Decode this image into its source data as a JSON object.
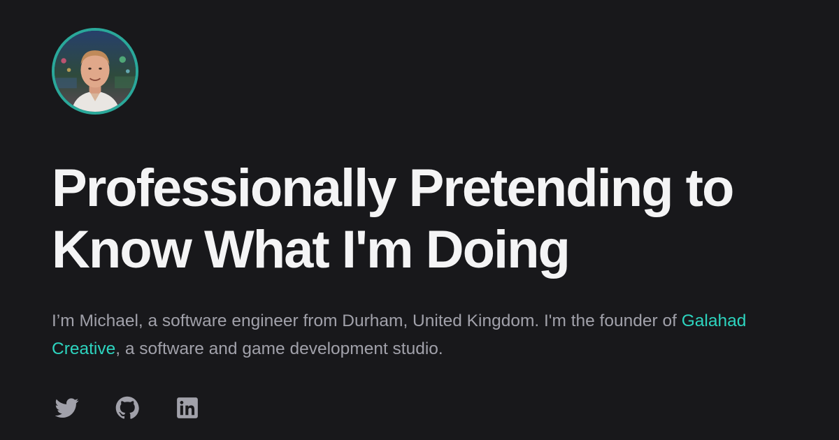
{
  "profile": {
    "avatar_icon": "profile-photo"
  },
  "hero": {
    "title_line1": "Professionally Pretending to",
    "title_line2": "Know What I'm Doing",
    "intro_before": "I’m Michael, a software engineer from Durham, United Kingdom. I'm the founder of ",
    "intro_link": "Galahad Creative",
    "intro_after": ", a software and game development studio."
  },
  "socials": [
    {
      "icon": "twitter-icon"
    },
    {
      "icon": "github-icon"
    },
    {
      "icon": "linkedin-icon"
    }
  ],
  "colors": {
    "background": "#18181b",
    "heading": "#f4f4f5",
    "body_text": "#a1a1aa",
    "accent": "#2dd4bf",
    "avatar_ring": "#2aa89a"
  }
}
